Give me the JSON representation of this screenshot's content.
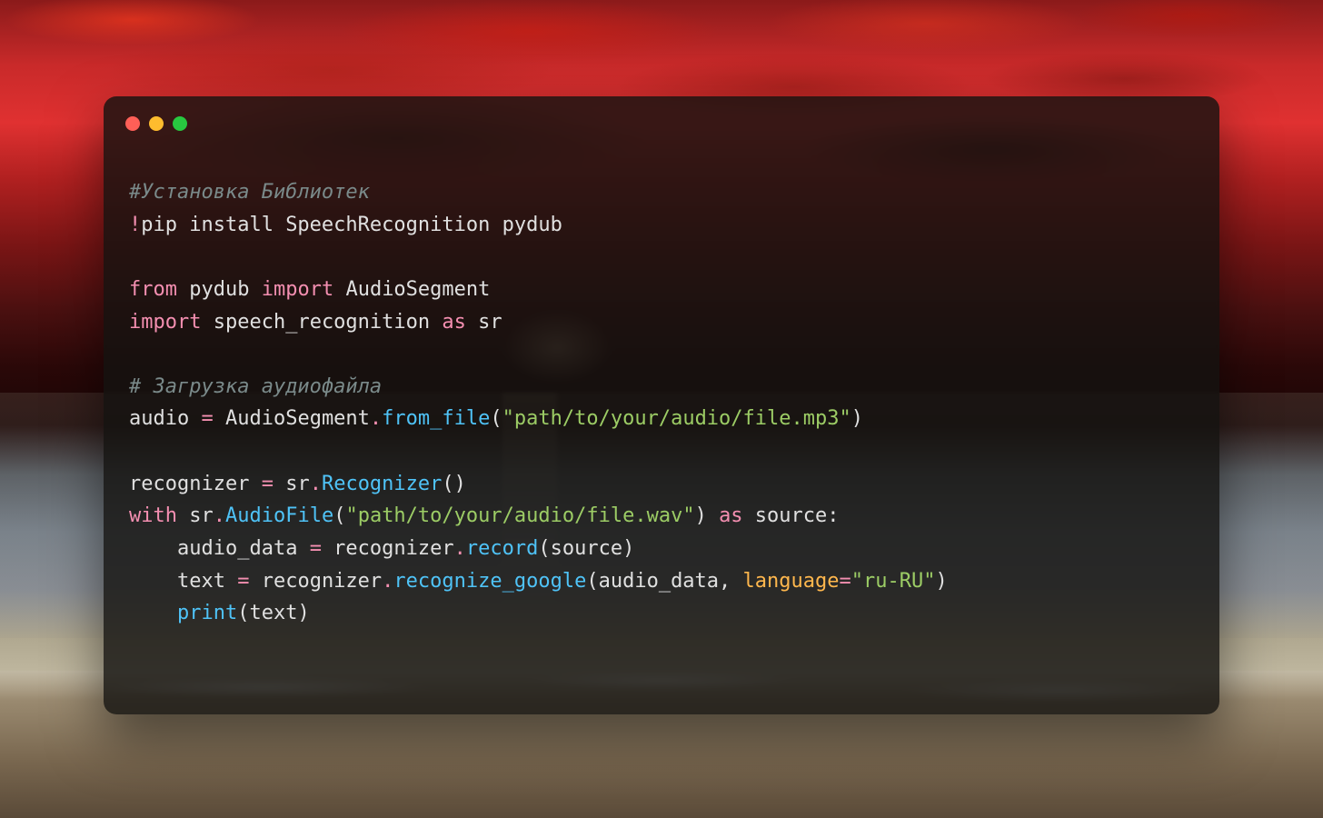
{
  "window": {
    "controls": [
      "close",
      "minimize",
      "maximize"
    ]
  },
  "code": {
    "lines": [
      {
        "segments": [
          {
            "cls": "tok-comment",
            "text": "#Установка Библиотек"
          }
        ]
      },
      {
        "segments": [
          {
            "cls": "tok-operator",
            "text": "!"
          },
          {
            "cls": "tok-cmd",
            "text": "pip install SpeechRecognition pydub"
          }
        ]
      },
      {
        "segments": [
          {
            "cls": "",
            "text": ""
          }
        ]
      },
      {
        "segments": [
          {
            "cls": "tok-keyword",
            "text": "from"
          },
          {
            "cls": "",
            "text": " "
          },
          {
            "cls": "tok-module",
            "text": "pydub"
          },
          {
            "cls": "",
            "text": " "
          },
          {
            "cls": "tok-keyword",
            "text": "import"
          },
          {
            "cls": "",
            "text": " "
          },
          {
            "cls": "tok-module",
            "text": "AudioSegment"
          }
        ]
      },
      {
        "segments": [
          {
            "cls": "tok-keyword",
            "text": "import"
          },
          {
            "cls": "",
            "text": " "
          },
          {
            "cls": "tok-module",
            "text": "speech_recognition"
          },
          {
            "cls": "",
            "text": " "
          },
          {
            "cls": "tok-keyword",
            "text": "as"
          },
          {
            "cls": "",
            "text": " "
          },
          {
            "cls": "tok-module",
            "text": "sr"
          }
        ]
      },
      {
        "segments": [
          {
            "cls": "",
            "text": ""
          }
        ]
      },
      {
        "segments": [
          {
            "cls": "tok-comment",
            "text": "# Загрузка аудиофайла"
          }
        ]
      },
      {
        "segments": [
          {
            "cls": "tok-ident",
            "text": "audio "
          },
          {
            "cls": "tok-operator",
            "text": "="
          },
          {
            "cls": "tok-ident",
            "text": " AudioSegment"
          },
          {
            "cls": "tok-operator",
            "text": "."
          },
          {
            "cls": "tok-func",
            "text": "from_file"
          },
          {
            "cls": "tok-paren",
            "text": "("
          },
          {
            "cls": "tok-string",
            "text": "\"path/to/your/audio/file.mp3\""
          },
          {
            "cls": "tok-paren",
            "text": ")"
          }
        ]
      },
      {
        "segments": [
          {
            "cls": "",
            "text": ""
          }
        ]
      },
      {
        "segments": [
          {
            "cls": "tok-ident",
            "text": "recognizer "
          },
          {
            "cls": "tok-operator",
            "text": "="
          },
          {
            "cls": "tok-ident",
            "text": " sr"
          },
          {
            "cls": "tok-operator",
            "text": "."
          },
          {
            "cls": "tok-class",
            "text": "Recognizer"
          },
          {
            "cls": "tok-paren",
            "text": "()"
          }
        ]
      },
      {
        "segments": [
          {
            "cls": "tok-keyword",
            "text": "with"
          },
          {
            "cls": "tok-ident",
            "text": " sr"
          },
          {
            "cls": "tok-operator",
            "text": "."
          },
          {
            "cls": "tok-class",
            "text": "AudioFile"
          },
          {
            "cls": "tok-paren",
            "text": "("
          },
          {
            "cls": "tok-string",
            "text": "\"path/to/your/audio/file.wav\""
          },
          {
            "cls": "tok-paren",
            "text": ")"
          },
          {
            "cls": "",
            "text": " "
          },
          {
            "cls": "tok-keyword",
            "text": "as"
          },
          {
            "cls": "tok-ident",
            "text": " source"
          },
          {
            "cls": "tok-paren",
            "text": ":"
          }
        ]
      },
      {
        "segments": [
          {
            "cls": "",
            "text": "    "
          },
          {
            "cls": "tok-ident",
            "text": "audio_data "
          },
          {
            "cls": "tok-operator",
            "text": "="
          },
          {
            "cls": "tok-ident",
            "text": " recognizer"
          },
          {
            "cls": "tok-operator",
            "text": "."
          },
          {
            "cls": "tok-func",
            "text": "record"
          },
          {
            "cls": "tok-paren",
            "text": "("
          },
          {
            "cls": "tok-ident",
            "text": "source"
          },
          {
            "cls": "tok-paren",
            "text": ")"
          }
        ]
      },
      {
        "segments": [
          {
            "cls": "",
            "text": "    "
          },
          {
            "cls": "tok-ident",
            "text": "text "
          },
          {
            "cls": "tok-operator",
            "text": "="
          },
          {
            "cls": "tok-ident",
            "text": " recognizer"
          },
          {
            "cls": "tok-operator",
            "text": "."
          },
          {
            "cls": "tok-func",
            "text": "recognize_google"
          },
          {
            "cls": "tok-paren",
            "text": "("
          },
          {
            "cls": "tok-ident",
            "text": "audio_data"
          },
          {
            "cls": "tok-paren",
            "text": ", "
          },
          {
            "cls": "tok-param",
            "text": "language"
          },
          {
            "cls": "tok-eq",
            "text": "="
          },
          {
            "cls": "tok-string",
            "text": "\"ru-RU\""
          },
          {
            "cls": "tok-paren",
            "text": ")"
          }
        ]
      },
      {
        "segments": [
          {
            "cls": "",
            "text": "    "
          },
          {
            "cls": "tok-builtin",
            "text": "print"
          },
          {
            "cls": "tok-paren",
            "text": "("
          },
          {
            "cls": "tok-ident",
            "text": "text"
          },
          {
            "cls": "tok-paren",
            "text": ")"
          }
        ]
      }
    ]
  }
}
